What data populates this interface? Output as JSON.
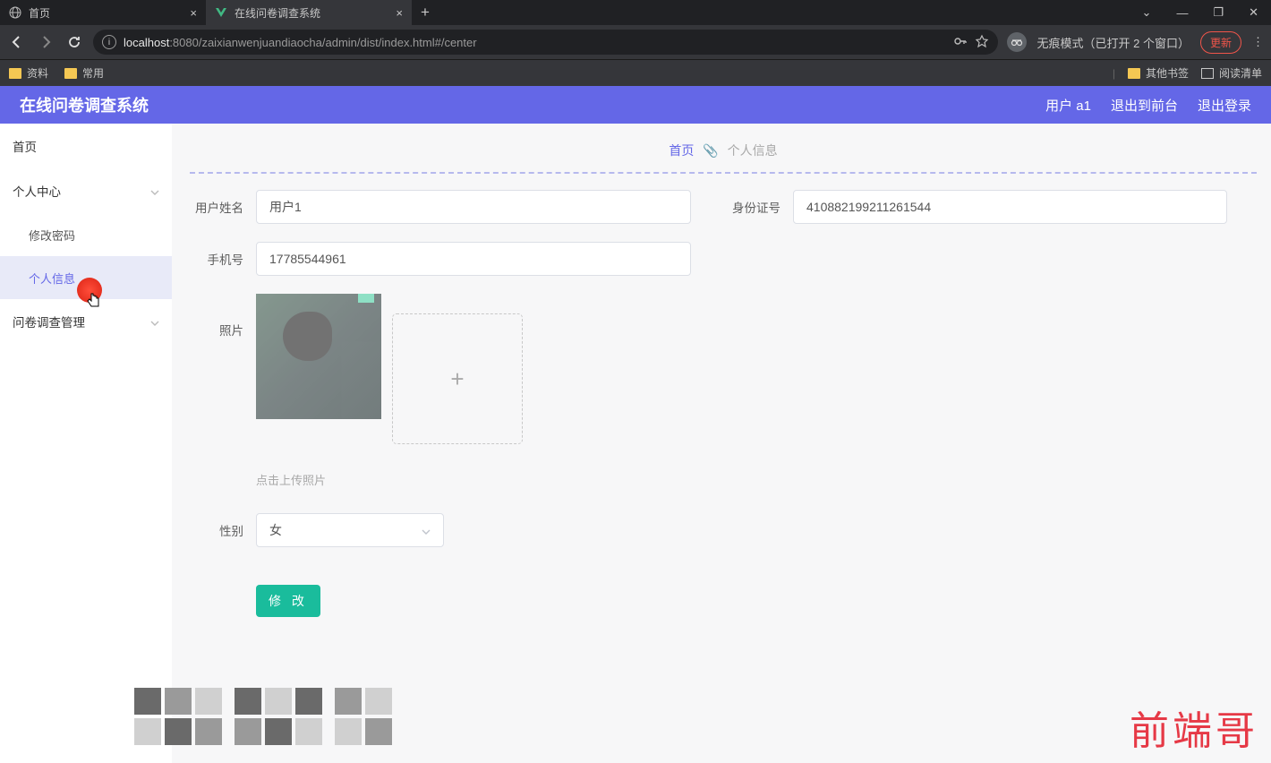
{
  "browser": {
    "tabs": [
      {
        "title": "首页",
        "icon": "globe"
      },
      {
        "title": "在线问卷调查系统",
        "icon": "vue"
      }
    ],
    "url": {
      "host": "localhost",
      "port_path": ":8080/zaixianwenjuandiaocha/admin/dist/index.html#/center"
    },
    "incognito_text": "无痕模式（已打开 2 个窗口）",
    "update_label": "更新",
    "bookmarks": [
      {
        "label": "资料"
      },
      {
        "label": "常用"
      }
    ],
    "other_bookmarks": "其他书签",
    "reading_list": "阅读清单"
  },
  "header": {
    "title": "在线问卷调查系统",
    "user": "用户 a1",
    "exit_front": "退出到前台",
    "logout": "退出登录"
  },
  "sidebar": {
    "home": "首页",
    "personal_center": "个人中心",
    "change_pwd": "修改密码",
    "personal_info": "个人信息",
    "survey_mgmt": "问卷调查管理"
  },
  "breadcrumb": {
    "home": "首页",
    "current": "个人信息"
  },
  "form": {
    "username_label": "用户姓名",
    "username_value": "用户1",
    "idcard_label": "身份证号",
    "idcard_value": "410882199211261544",
    "phone_label": "手机号",
    "phone_value": "17785544961",
    "photo_label": "照片",
    "upload_hint": "点击上传照片",
    "gender_label": "性别",
    "gender_value": "女",
    "submit_label": "修 改"
  },
  "watermark": "前端哥"
}
